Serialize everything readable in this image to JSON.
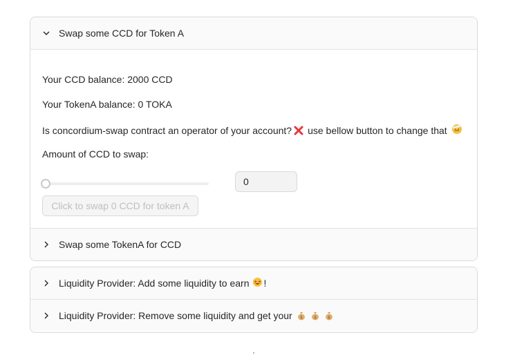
{
  "panels": [
    {
      "title": "Swap some CCD for Token A",
      "expanded": true,
      "ccd_balance": "Your CCD balance: 2000 CCD",
      "token_balance": "Your TokenA balance: 0 TOKA",
      "operator_question": "Is concordium-swap contract an operator of your account?",
      "operator_status_icon": "cross-mark-icon",
      "operator_hint": "use bellow button to change that",
      "operator_hint_emoji": "face-with-head-bandage-icon",
      "amount_label": "Amount of CCD to swap:",
      "slider_value": 0,
      "amount_value": "0",
      "swap_button_label": "Click to swap 0 CCD for token A"
    },
    {
      "title": "Swap some TokenA for CCD",
      "expanded": false
    }
  ],
  "liquidity_panels": [
    {
      "title": "Liquidity Provider: Add some liquidity to earn",
      "emoji": "grinning-squinting-face-icon",
      "suffix": "!"
    },
    {
      "title": "Liquidity Provider: Remove some liquidity and get your",
      "emoji": "money-bag-icon"
    }
  ],
  "colors": {
    "header_bg": "#fafafa",
    "border": "#d9d9d9",
    "cross": "#e8343d",
    "disabled_text": "#bfbfbf"
  }
}
